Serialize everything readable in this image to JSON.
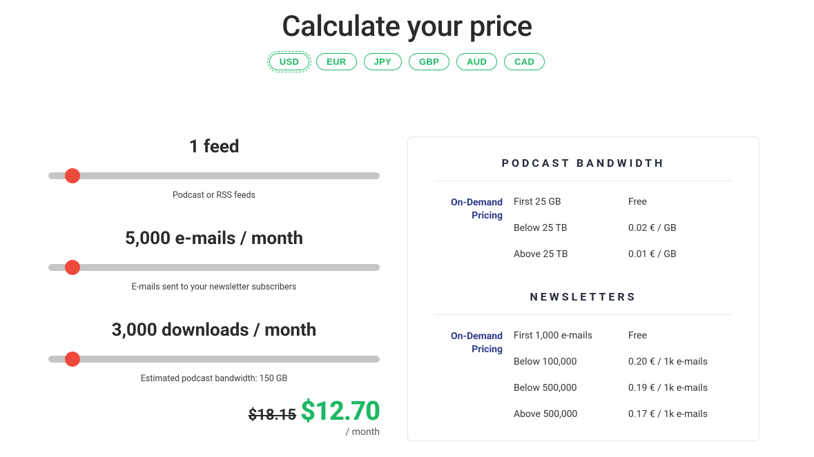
{
  "header": {
    "title": "Calculate your price",
    "currencies": [
      "USD",
      "EUR",
      "JPY",
      "GBP",
      "AUD",
      "CAD"
    ],
    "active_currency": "USD"
  },
  "sliders": {
    "feeds": {
      "heading": "1 feed",
      "caption": "Podcast or RSS feeds",
      "thumb_pct": 5
    },
    "emails": {
      "heading": "5,000 e-mails / month",
      "caption": "E-mails sent to your newsletter subscribers",
      "thumb_pct": 5
    },
    "downloads": {
      "heading": "3,000 downloads / month",
      "caption": "Estimated podcast bandwidth: 150 GB",
      "thumb_pct": 5
    }
  },
  "price": {
    "old": "$18.15",
    "new": "$12.70",
    "period": "/ month"
  },
  "bandwidth": {
    "title": "PODCAST BANDWIDTH",
    "label": "On-Demand Pricing",
    "rows": [
      {
        "tier": "First 25 GB",
        "price": "Free"
      },
      {
        "tier": "Below 25 TB",
        "price": "0.02 € / GB"
      },
      {
        "tier": "Above 25 TB",
        "price": "0.01 € / GB"
      }
    ]
  },
  "newsletters": {
    "title": "NEWSLETTERS",
    "label": "On-Demand Pricing",
    "rows": [
      {
        "tier": "First 1,000 e-mails",
        "price": "Free"
      },
      {
        "tier": "Below 100,000",
        "price": "0.20 € / 1k e-mails"
      },
      {
        "tier": "Below 500,000",
        "price": "0.19 € / 1k e-mails"
      },
      {
        "tier": "Above 500,000",
        "price": "0.17 € / 1k e-mails"
      }
    ]
  }
}
